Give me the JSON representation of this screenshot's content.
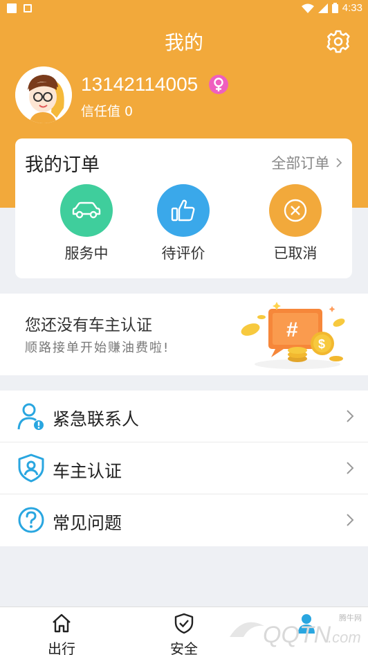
{
  "status_bar": {
    "time": "4:33"
  },
  "header": {
    "title": "我的"
  },
  "profile": {
    "phone": "13142114005",
    "trust": "信任值 0",
    "gender_symbol": "♀"
  },
  "orders": {
    "title": "我的订单",
    "all_orders": "全部订单",
    "items": [
      {
        "label": "服务中",
        "icon": "car-icon",
        "color": "#3fce9c"
      },
      {
        "label": "待评价",
        "icon": "thumbs-up-icon",
        "color": "#3aa8ea"
      },
      {
        "label": "已取消",
        "icon": "cancel-icon",
        "color": "#f2a93b"
      }
    ]
  },
  "banner": {
    "title": "您还没有车主认证",
    "subtitle": "顺路接单开始赚油费啦!",
    "art_text": "#"
  },
  "menu": [
    {
      "label": "紧急联系人",
      "icon": "emergency-contact-icon"
    },
    {
      "label": "车主认证",
      "icon": "shield-user-icon"
    },
    {
      "label": "常见问题",
      "icon": "help-icon"
    }
  ],
  "tabs": [
    {
      "label": "出行",
      "icon": "home-icon"
    },
    {
      "label": "安全",
      "icon": "shield-check-icon"
    },
    {
      "label": "",
      "icon": "user-icon"
    }
  ],
  "watermark": {
    "brand": "QQTN",
    "suffix": ".com",
    "cn": "腾牛网"
  },
  "colors": {
    "accent": "#f2a93b",
    "icon_blue": "#29a6e0"
  }
}
